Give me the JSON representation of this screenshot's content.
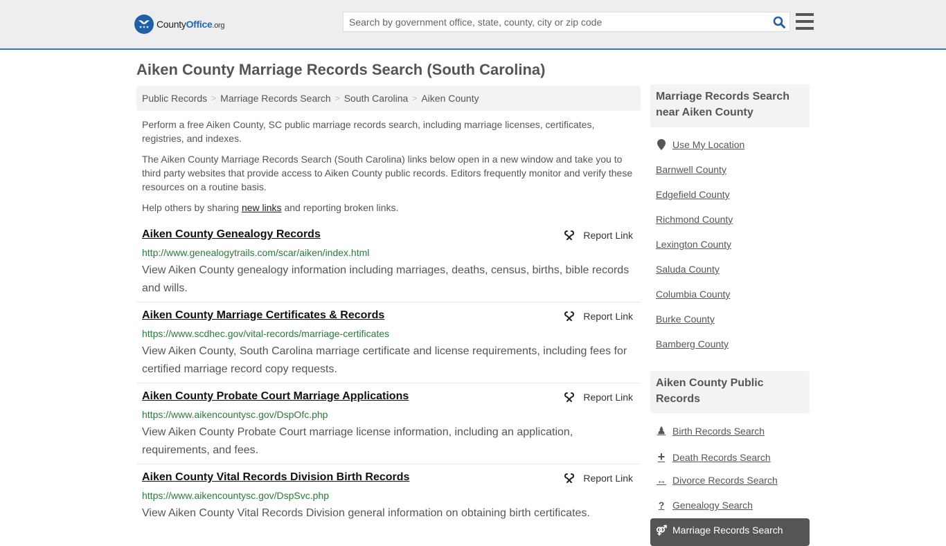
{
  "header": {
    "logo": {
      "brand_part1": "County",
      "brand_part2": "Office",
      "brand_suffix": ".org"
    },
    "search": {
      "placeholder": "Search by government office, state, county, city or zip code",
      "value": ""
    },
    "colors": {
      "accent": "#3a77ab",
      "logo_blue": "#1e5fa8"
    }
  },
  "page": {
    "title": "Aiken County Marriage Records Search (South Carolina)"
  },
  "breadcrumb": [
    "Public Records",
    "Marriage Records Search",
    "South Carolina",
    "Aiken County"
  ],
  "intro": {
    "p1": "Perform a free Aiken County, SC public marriage records search, including marriage licenses, certificates, registries, and indexes.",
    "p2": "The Aiken County Marriage Records Search (South Carolina) links below open in a new window and take you to third party websites that provide access to Aiken County public records. Editors frequently monitor and verify these resources on a routine basis.",
    "p3_before": "Help others by sharing ",
    "p3_link": "new links",
    "p3_after": " and reporting broken links."
  },
  "results": [
    {
      "title": "Aiken County Genealogy Records",
      "url": "http://www.genealogytrails.com/scar/aiken/index.html",
      "description": "View Aiken County genealogy information including marriages, deaths, census, births, bible records and wills.",
      "report_label": "Report Link"
    },
    {
      "title": "Aiken County Marriage Certificates & Records",
      "url": "https://www.scdhec.gov/vital-records/marriage-certificates",
      "description": "View Aiken County, South Carolina marriage certificate and license requirements, including fees for certified marriage record copy requests.",
      "report_label": "Report Link"
    },
    {
      "title": "Aiken County Probate Court Marriage Applications",
      "url": "https://www.aikencountysc.gov/DspOfc.php",
      "description": "View Aiken County Probate Court marriage license information, including an application, requirements, and fees.",
      "report_label": "Report Link"
    },
    {
      "title": "Aiken County Vital Records Division Birth Records",
      "url": "https://www.aikencountysc.gov/DspSvc.php",
      "description": "View Aiken County Vital Records Division general information on obtaining birth certificates.",
      "report_label": "Report Link"
    }
  ],
  "sidebar": {
    "nearby": {
      "heading": "Marriage Records Search near Aiken County",
      "use_location": "Use My Location",
      "counties": [
        "Barnwell County",
        "Edgefield County",
        "Richmond County",
        "Lexington County",
        "Saluda County",
        "Columbia County",
        "Burke County",
        "Bamberg County"
      ]
    },
    "public_records": {
      "heading": "Aiken County Public Records",
      "items": [
        {
          "label": "Birth Records Search",
          "icon": "child-icon",
          "glyph": "♟"
        },
        {
          "label": "Death Records Search",
          "icon": "plus-icon",
          "glyph": "+"
        },
        {
          "label": "Divorce Records Search",
          "icon": "arrows-horizontal-icon",
          "glyph": "↔"
        },
        {
          "label": "Genealogy Search",
          "icon": "question-icon",
          "glyph": "?"
        },
        {
          "label": "Marriage Records Search",
          "icon": "venus-mars-icon",
          "glyph": "⚤",
          "active": true
        }
      ]
    }
  }
}
